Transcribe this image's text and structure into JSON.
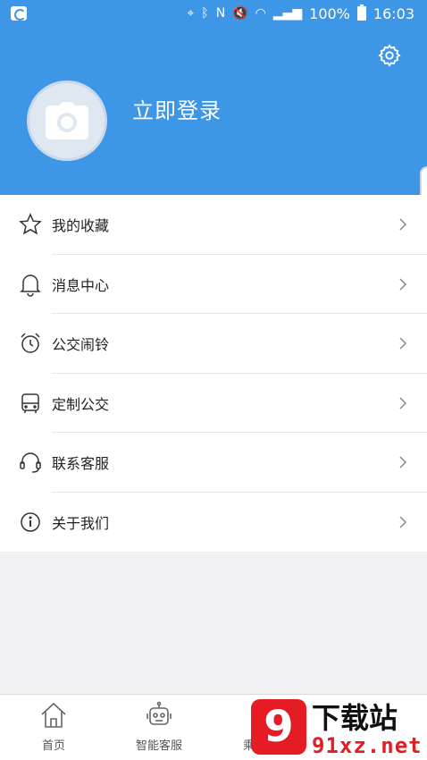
{
  "status_bar": {
    "battery": "100%",
    "time": "16:03"
  },
  "header": {
    "login_text": "立即登录",
    "accent_color": "#3d96e6"
  },
  "menu": [
    {
      "label": "我的收藏",
      "icon": "star-icon"
    },
    {
      "label": "消息中心",
      "icon": "bell-icon"
    },
    {
      "label": "公交闹铃",
      "icon": "alarm-clock-icon"
    },
    {
      "label": "定制公交",
      "icon": "bus-icon"
    },
    {
      "label": "联系客服",
      "icon": "headset-icon"
    },
    {
      "label": "关于我们",
      "icon": "info-icon"
    }
  ],
  "tabbar": [
    {
      "label": "首页",
      "icon": "home-icon"
    },
    {
      "label": "智能客服",
      "icon": "robot-icon"
    },
    {
      "label": "乘客系列",
      "icon": "passenger-icon"
    }
  ],
  "watermark": {
    "title": "下载站",
    "subtitle": "91xz.net",
    "logo_text": "9"
  }
}
